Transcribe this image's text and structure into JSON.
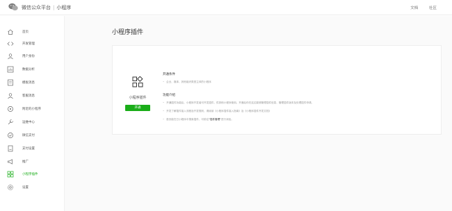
{
  "topbar": {
    "brand": "微信公众平台",
    "separator": "|",
    "section": "小程序",
    "links": [
      "文档",
      "社区"
    ]
  },
  "sidebar": {
    "items": [
      {
        "label": "首页",
        "icon": "home-icon",
        "active": false
      },
      {
        "label": "开发管理",
        "icon": "code-icon",
        "active": false
      },
      {
        "label": "用户身份",
        "icon": "user-icon",
        "active": false
      },
      {
        "label": "数据分析",
        "icon": "chart-icon",
        "active": false
      },
      {
        "label": "模板消息",
        "icon": "template-icon",
        "active": false
      },
      {
        "label": "客服消息",
        "icon": "customer-service-icon",
        "active": false
      },
      {
        "label": "附近的小程序",
        "icon": "location-icon",
        "active": false
      },
      {
        "label": "运维中心",
        "icon": "wrench-icon",
        "active": false
      },
      {
        "label": "微信支付",
        "icon": "pay-icon",
        "active": false
      },
      {
        "label": "支付设置",
        "icon": "pay-settings-icon",
        "active": false
      },
      {
        "label": "推广",
        "icon": "promotion-icon",
        "active": false
      },
      {
        "label": "小程序插件",
        "icon": "plugin-icon",
        "active": true
      },
      {
        "label": "设置",
        "icon": "settings-icon",
        "active": false
      }
    ]
  },
  "main": {
    "title": "小程序插件",
    "card": {
      "plugin_name": "小程序插件",
      "open_button": "开通",
      "open_scope_title": "开通条件",
      "open_scope_text": "企业、媒体、其他组织类型主体的小程序",
      "intro_title": "功能介绍",
      "bullets": [
        {
          "text": "开通插件功能后，小程序开发者可开发插件，供其他小程序使用。开通后你在这边能够管理插件信息、管理插件版本及处理插件申请。"
        },
        {
          "text": "开发了解插件接入流程及开发规则，请阅读《小程序插件接入指南》及《小程序插件开发文档》"
        },
        {
          "text_before": "首页能在已小程序中搜索插件，可前往",
          "highlight": "\"插件管理\"",
          "text_after": "进行添加。"
        }
      ]
    }
  }
}
